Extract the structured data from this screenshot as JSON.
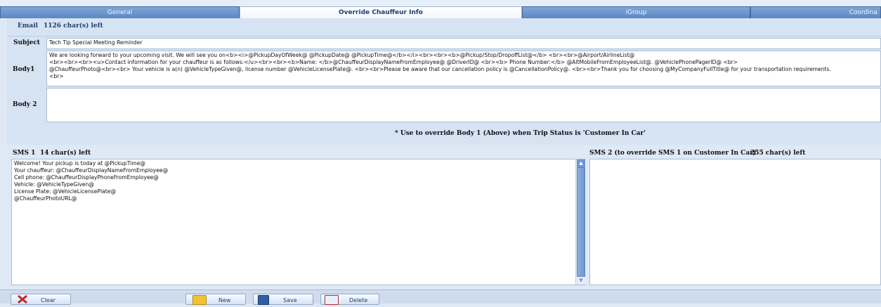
{
  "tabs": [
    {
      "label": "General"
    },
    {
      "label": "Override Chauffeur Info"
    },
    {
      "label": "iGroup"
    },
    {
      "label": "Coordina"
    }
  ],
  "email": {
    "label": "Email",
    "chars_left": "1126 char(s) left"
  },
  "subject": {
    "label": "Subject",
    "value": "Tech Tip Special Meeting Reminder"
  },
  "body1": {
    "label": "Body1",
    "value": "We are looking forward to your upcoming visit.  We will see you on<b><i>@PickupDayOfWeek@ @PickupDate@ @PickupTime@</b></i><br><br><b>@Pickup/Stop/DropoffList@</b> <br><br>@Airport/AirlineList@\n<br><br><br><u>Contact information for your chauffeur is as follows:</u><br><br><b>Name: </b>@ChauffeurDisplayNameFromEmployee@  @DriverID@ <br><b> Phone Number:</b> @AltMobileFromEmployeeList@. @VehiclePhonePagerID@ <br>\n@ChauffeurPhoto@<br><br> Your vehicle is a(n) @VehicleTypeGiven@, license number @VehicleLicensePlate@. <br><br>Please be aware that our cancellation policy is @CancellationPolicy@.  <br><br>Thank you for choosing @MyCompanyFullTitle@ for your transportation requirements.\n<br>"
  },
  "body2": {
    "label": "Body 2",
    "value": ""
  },
  "body_note": "*  Use to override Body 1 (Above) when Trip Status is 'Customer In Car'",
  "sms1": {
    "label": "SMS 1",
    "chars_left": "14 char(s) left",
    "value": "Welcome! Your pickup is today at @PickupTime@\nYour chauffeur:  @ChauffeurDisplayNameFromEmployee@\nCell phone:  @ChauffeurDisplayPhoneFromEmployee@\nVehicle:  @VehicleTypeGiven@\nLicense Plate:  @VehicleLicensePlate@\n@ChauffeurPhotoURL@"
  },
  "sms2": {
    "label": "SMS 2 (to override SMS 1 on Customer In Car)",
    "chars_left": "255 char(s) left",
    "value": ""
  },
  "buttons": {
    "clear": "Clear",
    "new": "New",
    "save": "Save",
    "delete": "Delete"
  },
  "icons": {
    "clear": "clear-icon",
    "new": "new-icon",
    "save": "save-icon",
    "delete": "delete-icon"
  },
  "colors": {
    "tab_active_text": "#1e3f73",
    "label_blue": "#1f3f6d",
    "tab_bar": "#5b87c1"
  }
}
